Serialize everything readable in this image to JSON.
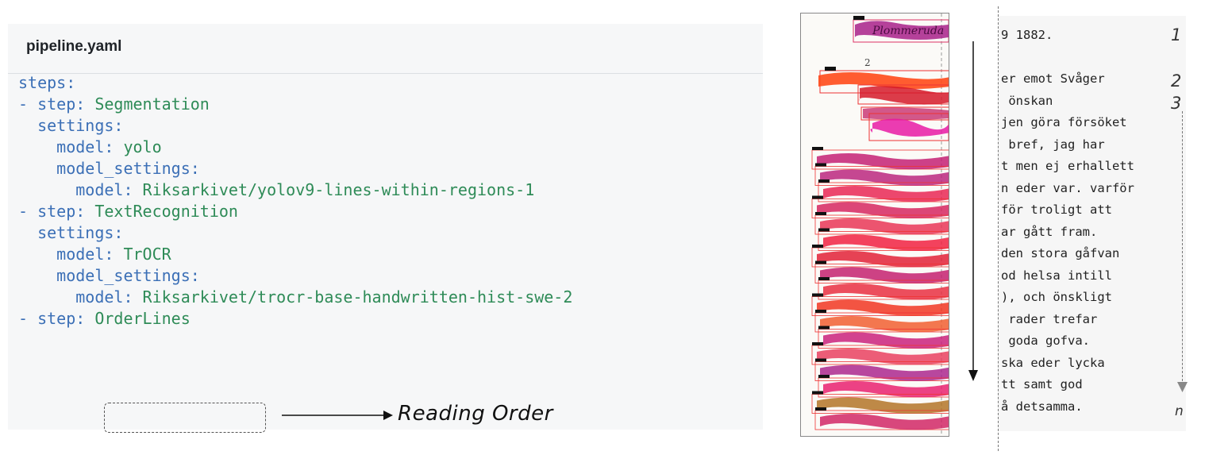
{
  "yaml": {
    "title": "pipeline.yaml",
    "lines": [
      {
        "k": "steps",
        "p": ":",
        "v": ""
      },
      {
        "k": "- step",
        "p": ": ",
        "v": "Segmentation"
      },
      {
        "k": "  settings",
        "p": ":",
        "v": ""
      },
      {
        "k": "    model",
        "p": ": ",
        "v": "yolo"
      },
      {
        "k": "    model_settings",
        "p": ":",
        "v": ""
      },
      {
        "k": "      model",
        "p": ": ",
        "v": "Riksarkivet/yolov9-lines-within-regions-1"
      },
      {
        "k": "- step",
        "p": ": ",
        "v": "TextRecognition"
      },
      {
        "k": "  settings",
        "p": ":",
        "v": ""
      },
      {
        "k": "    model",
        "p": ": ",
        "v": "TrOCR"
      },
      {
        "k": "    model_settings",
        "p": ":",
        "v": ""
      },
      {
        "k": "      model",
        "p": ": ",
        "v": "Riksarkivet/trocr-base-handwritten-hist-swe-2"
      },
      {
        "k": "- step",
        "p": ": ",
        "v": "OrderLines"
      }
    ]
  },
  "annotation": {
    "reading_order_label": "Reading Order"
  },
  "transcription": {
    "lines": [
      "9 1882.",
      "",
      "er emot Svåger",
      " önskan",
      "jen göra försöket",
      " bref, jag har",
      "t men ej erhallett",
      "n eder var. varför",
      "för troligt att",
      "ar gått fram.",
      "den stora gåfvan",
      "od helsa intill",
      "), och önskligt",
      " rader trefar",
      " goda gofva.",
      "ska eder lycka",
      "tt samt god",
      "å detsamma."
    ],
    "line_numbers": [
      "1",
      "2",
      "3",
      "n"
    ]
  },
  "colors": {
    "key": "#3b6fb6",
    "value": "#2e8b57",
    "panel_bg": "#f6f7f8"
  }
}
